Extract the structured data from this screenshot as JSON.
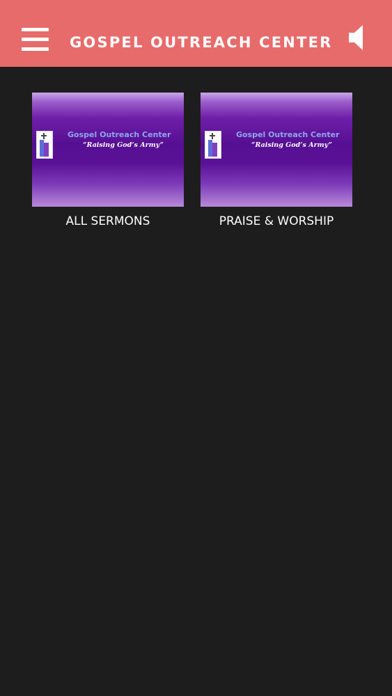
{
  "header": {
    "title": "GOSPEL OUTREACH CENTER",
    "menu_icon": "hamburger-menu-icon",
    "speaker_icon": "speaker-icon",
    "background_color": "#e86b6b"
  },
  "content": {
    "background_color": "#1d1d1d",
    "tiles": [
      {
        "label": "ALL SERMONS",
        "thumbnail": {
          "name": "Gospel Outreach Center",
          "tagline": "“Raising God’s Army”"
        }
      },
      {
        "label": "PRAISE & WORSHIP",
        "thumbnail": {
          "name": "Gospel Outreach Center",
          "tagline": "“Raising God’s Army”"
        }
      }
    ]
  }
}
